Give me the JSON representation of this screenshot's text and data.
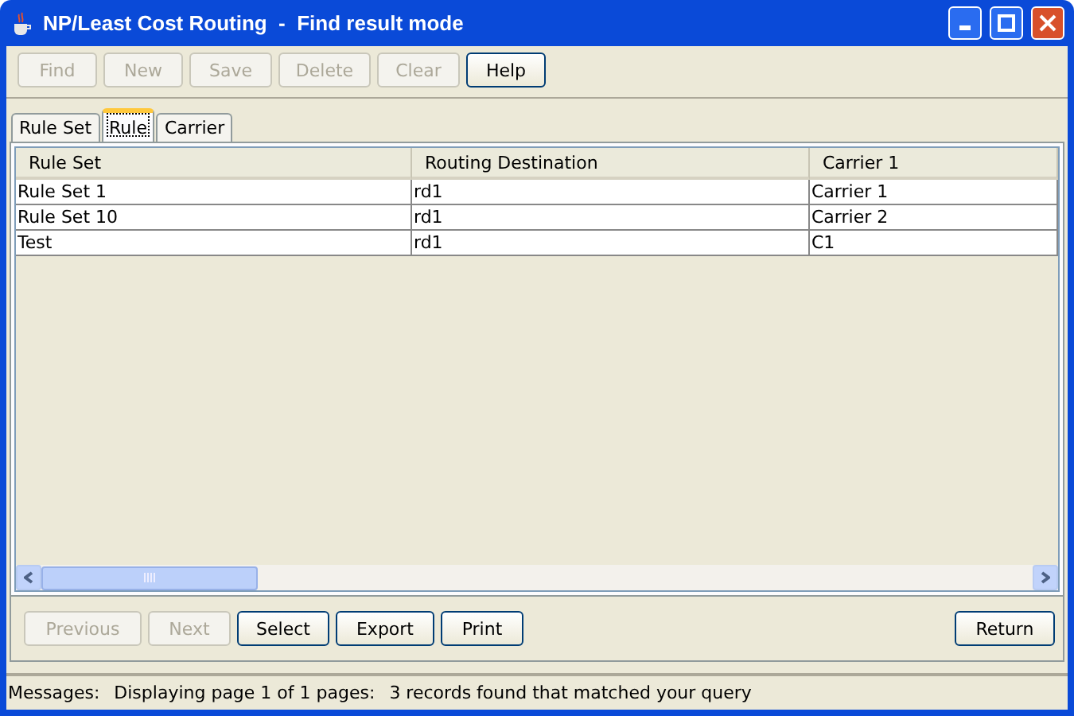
{
  "window": {
    "title": "NP/Least Cost Routing  -  Find result mode"
  },
  "toolbar": [
    {
      "label": "Find",
      "disabled": true
    },
    {
      "label": "New",
      "disabled": true
    },
    {
      "label": "Save",
      "disabled": true
    },
    {
      "label": "Delete",
      "disabled": true
    },
    {
      "label": "Clear",
      "disabled": true
    },
    {
      "label": "Help",
      "disabled": false
    }
  ],
  "tabs": [
    {
      "label": "Rule Set",
      "selected": false
    },
    {
      "label": "Rule",
      "selected": true
    },
    {
      "label": "Carrier",
      "selected": false
    }
  ],
  "table": {
    "columns": [
      "Rule Set",
      "Routing Destination",
      "Carrier 1"
    ],
    "rows": [
      [
        "Rule Set 1",
        "rd1",
        "Carrier 1"
      ],
      [
        "Rule Set 10",
        "rd1",
        "Carrier 2"
      ],
      [
        "Test",
        "rd1",
        "C1"
      ]
    ]
  },
  "footer_buttons": [
    {
      "label": "Previous",
      "disabled": true
    },
    {
      "label": "Next",
      "disabled": true
    },
    {
      "label": "Select",
      "disabled": false
    },
    {
      "label": "Export",
      "disabled": false
    },
    {
      "label": "Print",
      "disabled": false
    }
  ],
  "return_button": {
    "label": "Return"
  },
  "status_bar": {
    "label": "Messages:",
    "parts": [
      "Displaying page 1 of 1 pages:",
      "3 records found that matched your query"
    ]
  }
}
